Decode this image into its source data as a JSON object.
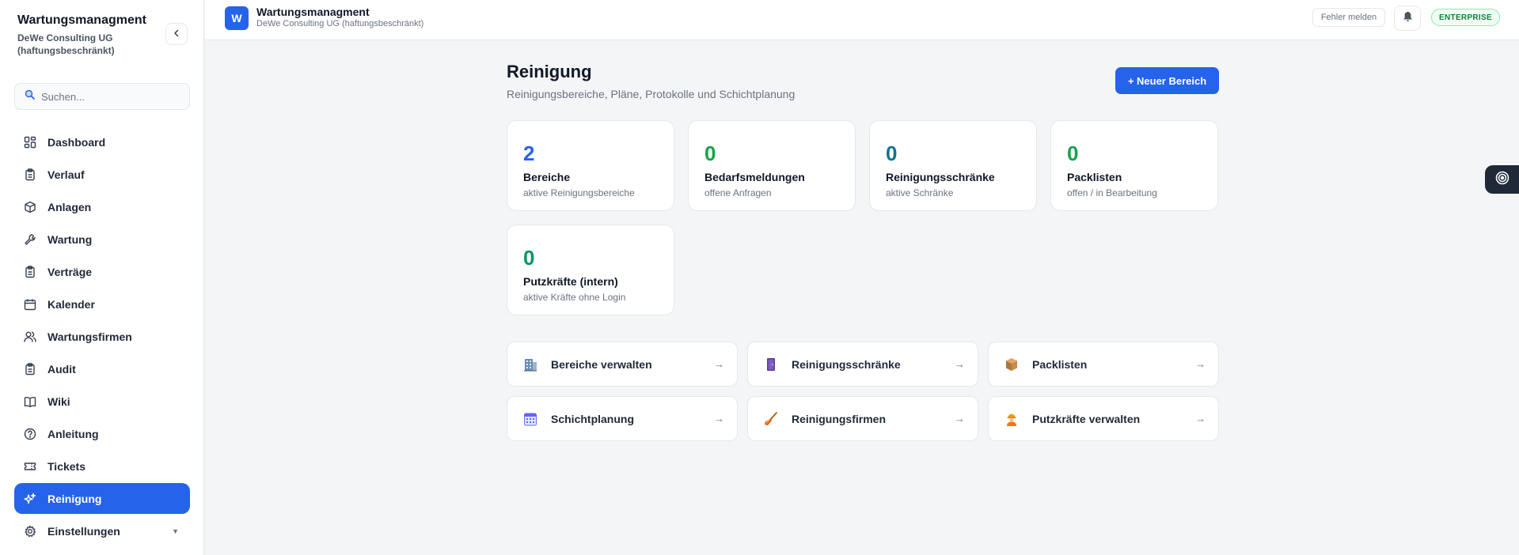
{
  "sidebar": {
    "brand_title": "Wartungsmanagment",
    "brand_subtitle": "DeWe Consulting UG (haftungsbeschränkt)",
    "search_placeholder": "Suchen...",
    "items": [
      {
        "label": "Dashboard",
        "icon": "dashboard-icon"
      },
      {
        "label": "Verlauf",
        "icon": "clipboard-icon"
      },
      {
        "label": "Anlagen",
        "icon": "box-icon"
      },
      {
        "label": "Wartung",
        "icon": "wrench-icon"
      },
      {
        "label": "Verträge",
        "icon": "clipboard-icon"
      },
      {
        "label": "Kalender",
        "icon": "calendar-icon"
      },
      {
        "label": "Wartungsfirmen",
        "icon": "users-icon"
      },
      {
        "label": "Audit",
        "icon": "clipboard-icon"
      },
      {
        "label": "Wiki",
        "icon": "book-icon"
      },
      {
        "label": "Anleitung",
        "icon": "help-circle-icon"
      },
      {
        "label": "Tickets",
        "icon": "ticket-icon"
      },
      {
        "label": "Reinigung",
        "icon": "sparkles-icon",
        "active": true
      },
      {
        "label": "Einstellungen",
        "icon": "gear-icon"
      }
    ]
  },
  "topbar": {
    "logo_letter": "W",
    "title": "Wartungsmanagment",
    "subtitle": "DeWe Consulting UG (haftungsbeschränkt)",
    "report_label": "Fehler melden",
    "plan_badge": "ENTERPRISE"
  },
  "main": {
    "title": "Reinigung",
    "subtitle": "Reinigungsbereiche, Pläne, Protokolle und Schichtplanung",
    "new_button": "+ Neuer Bereich",
    "stats": [
      {
        "value": "2",
        "label": "Bereiche",
        "desc": "aktive Reinigungsbereiche",
        "color": "#2563eb"
      },
      {
        "value": "0",
        "label": "Bedarfsmeldungen",
        "desc": "offene Anfragen",
        "color": "#16a34a"
      },
      {
        "value": "0",
        "label": "Reinigungsschränke",
        "desc": "aktive Schränke",
        "color": "#0e7490"
      },
      {
        "value": "0",
        "label": "Packlisten",
        "desc": "offen / in Bearbeitung",
        "color": "#16a34a"
      },
      {
        "value": "0",
        "label": "Putzkräfte (intern)",
        "desc": "aktive Kräfte ohne Login",
        "color": "#059669"
      }
    ],
    "links": [
      {
        "label": "Bereiche verwalten",
        "icon": "building-icon"
      },
      {
        "label": "Reinigungsschränke",
        "icon": "cabinet-icon"
      },
      {
        "label": "Packlisten",
        "icon": "package-icon"
      },
      {
        "label": "Schichtplanung",
        "icon": "calendar-grid-icon"
      },
      {
        "label": "Reinigungsfirmen",
        "icon": "broom-icon"
      },
      {
        "label": "Putzkräfte verwalten",
        "icon": "worker-icon"
      }
    ],
    "arrow": "→"
  },
  "colors": {
    "accent": "#2563eb",
    "enterprise": "#15803d"
  }
}
